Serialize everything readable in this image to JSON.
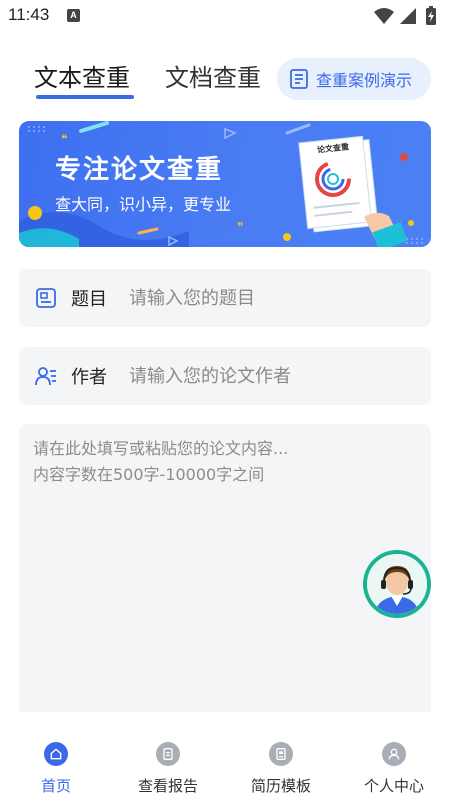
{
  "status_bar": {
    "time": "11:43",
    "app_icon_letter": "A"
  },
  "tabs": [
    {
      "label": "文本查重",
      "active": true
    },
    {
      "label": "文档查重",
      "active": false
    }
  ],
  "demo_button": {
    "label": "查重案例演示",
    "icon": "list-doc-icon"
  },
  "banner": {
    "title": "专注论文查重",
    "subtitle": "查大同，识小异，更专业",
    "doc_label": "论文查重"
  },
  "form": {
    "title_field": {
      "label": "题目",
      "placeholder": "请输入您的题目",
      "value": "",
      "icon": "title-icon"
    },
    "author_field": {
      "label": "作者",
      "placeholder": "请输入您的论文作者",
      "value": "",
      "icon": "author-icon"
    },
    "content_field": {
      "placeholder": "请在此处填写或粘贴您的论文内容...\n内容字数在500字-10000字之间",
      "value": ""
    }
  },
  "support": {
    "icon": "customer-service-icon"
  },
  "bottom_nav": [
    {
      "label": "首页",
      "icon": "home-icon",
      "active": true
    },
    {
      "label": "查看报告",
      "icon": "report-icon",
      "active": false
    },
    {
      "label": "简历模板",
      "icon": "template-icon",
      "active": false
    },
    {
      "label": "个人中心",
      "icon": "profile-icon",
      "active": false
    }
  ],
  "colors": {
    "accent": "#3a6ae8",
    "field_bg": "#f4f5f7",
    "support_ring": "#1ab394"
  }
}
